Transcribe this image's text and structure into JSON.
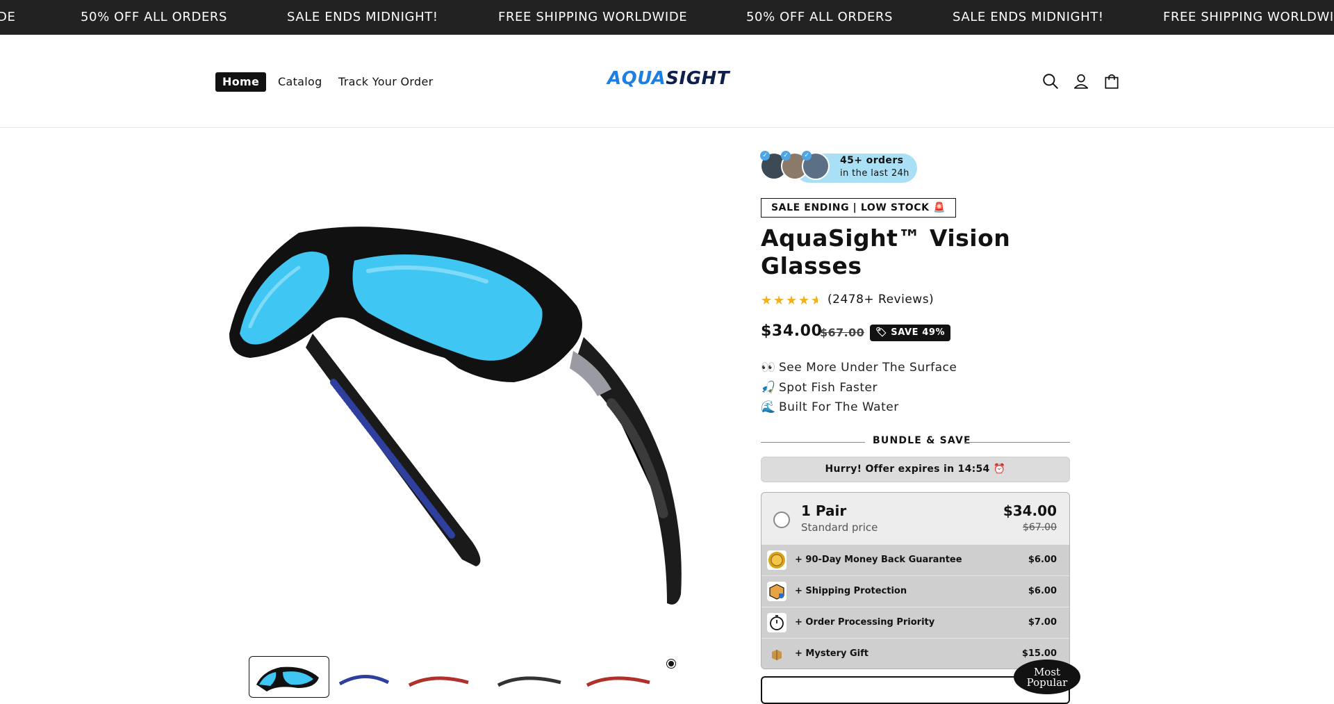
{
  "announcement": {
    "messages": [
      "DE",
      "50% OFF ALL ORDERS",
      "SALE ENDS MIDNIGHT!",
      "FREE SHIPPING WORLDWIDE",
      "50% OFF ALL ORDERS",
      "SALE ENDS MIDNIGHT!",
      "FREE SHIPPING WORLDWIDE"
    ]
  },
  "header": {
    "nav": [
      "Home",
      "Catalog",
      "Track Your Order"
    ],
    "logo_left": "AQUA",
    "logo_right": "SIGHT",
    "icons": [
      "search-icon",
      "account-icon",
      "cart-icon"
    ]
  },
  "product": {
    "social_proof": {
      "line1": "45+ orders",
      "line2": "in the last 24h"
    },
    "urgency_badge": "SALE ENDING | LOW STOCK 🚨",
    "title": "AquaSight™ Vision Glasses",
    "rating": 4.5,
    "reviews": "(2478+ Reviews)",
    "price": "$34.00",
    "compare_price": "$67.00",
    "save_badge": "SAVE 49%",
    "features": [
      {
        "emoji": "👀",
        "text": "See More Under The Surface"
      },
      {
        "emoji": "🎣",
        "text": "Spot Fish Faster"
      },
      {
        "emoji": "🌊",
        "text": "Built For The Water"
      }
    ]
  },
  "bundle": {
    "heading": "BUNDLE & SAVE",
    "hurry": "Hurry! Offer expires in 14:54 ⏰",
    "option": {
      "title": "1 Pair",
      "subtitle": "Standard price",
      "price": "$34.00",
      "compare": "$67.00"
    },
    "addons": [
      {
        "label": "+ 90-Day Money Back Guarantee",
        "price": "$6.00",
        "icon": "guarantee-seal-icon"
      },
      {
        "label": "+ Shipping Protection",
        "price": "$6.00",
        "icon": "package-shield-icon"
      },
      {
        "label": "+ Order Processing Priority",
        "price": "$7.00",
        "icon": "stopwatch-icon"
      },
      {
        "label": "+ Mystery Gift",
        "price": "$15.00",
        "icon": "gift-box-icon"
      }
    ],
    "popular_badge_l1": "Most",
    "popular_badge_l2": "Popular"
  },
  "colors": {
    "announcement_bg": "#222222",
    "logo_aqua": "#1e7fe0",
    "logo_sight": "#0d1f4a",
    "lens_blue": "#3fc6f2",
    "social_pill": "#a9e0f5",
    "star": "#f2b01e"
  }
}
